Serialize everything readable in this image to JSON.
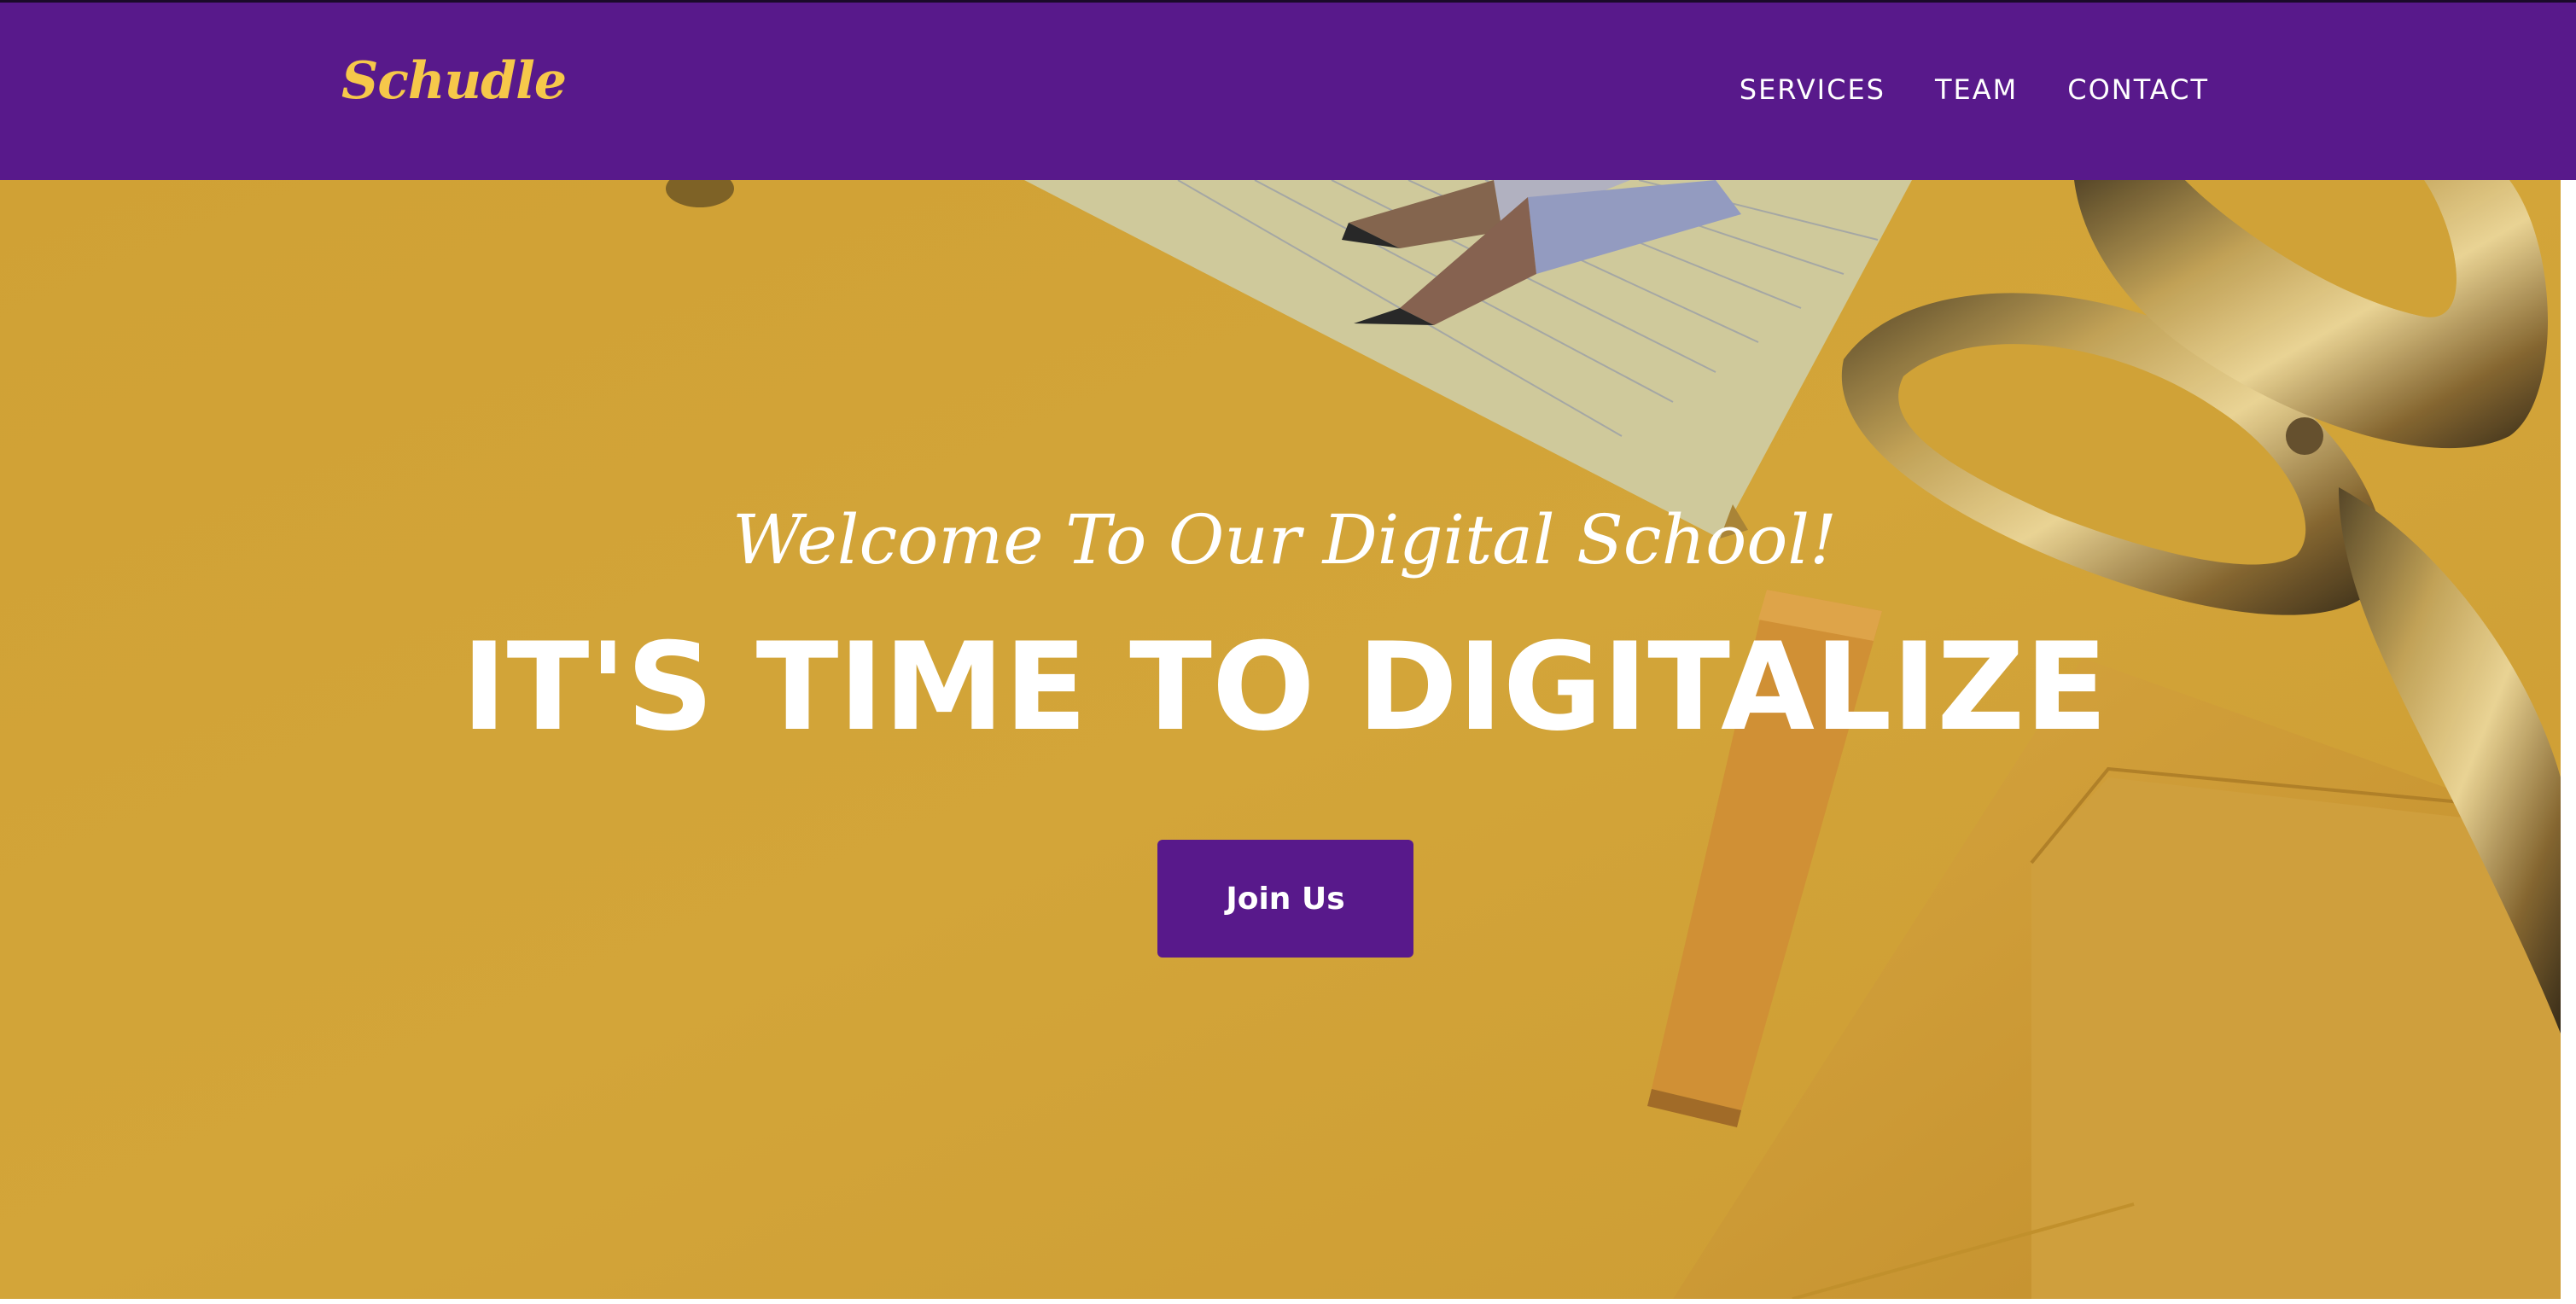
{
  "navbar": {
    "brand": "Schudle",
    "links": [
      {
        "label": "SERVICES"
      },
      {
        "label": "TEAM"
      },
      {
        "label": "CONTACT"
      }
    ]
  },
  "hero": {
    "welcome": "Welcome To Our Digital School!",
    "headline": "IT'S TIME TO DIGITALIZE",
    "cta_label": "Join Us"
  },
  "colors": {
    "brand_purple": "#58198b",
    "brand_yellow": "#f6c84a",
    "hero_background": "#d9a93a"
  },
  "icons": {
    "background_image": "desk-with-scissors-pencils-notepad-image"
  }
}
